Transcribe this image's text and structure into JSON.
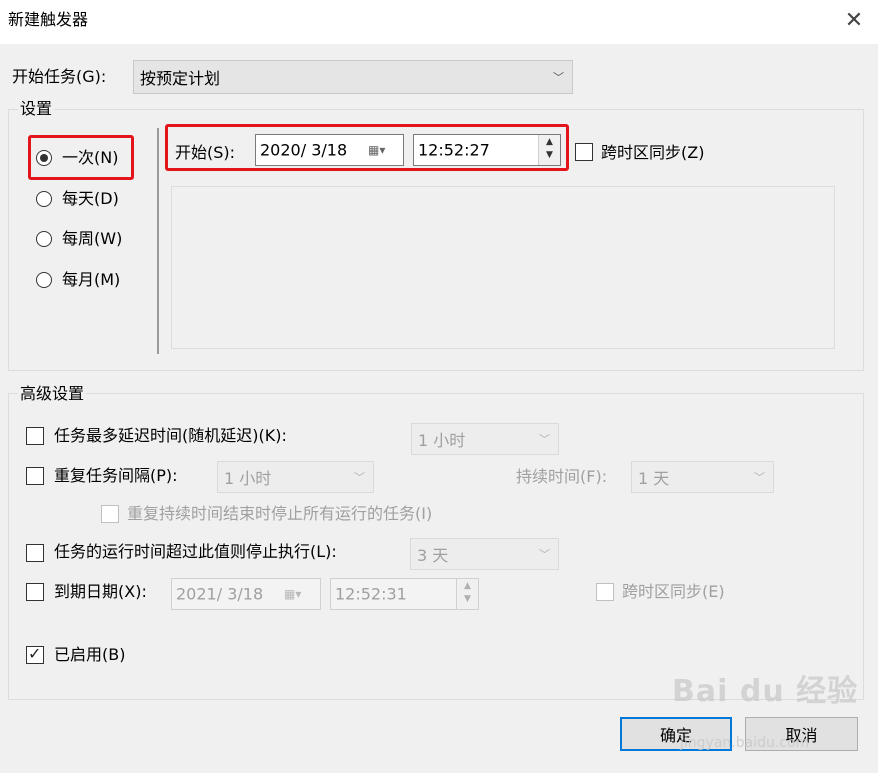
{
  "window": {
    "title": "新建触发器",
    "close_glyph": "✕"
  },
  "begin_task": {
    "label": "开始任务(G):",
    "value": "按预定计划"
  },
  "settings": {
    "title": "设置",
    "radios": [
      {
        "label": "一次(N)",
        "checked": true
      },
      {
        "label": "每天(D)",
        "checked": false
      },
      {
        "label": "每周(W)",
        "checked": false
      },
      {
        "label": "每月(M)",
        "checked": false
      }
    ],
    "start_label": "开始(S):",
    "start_date": "2020/  3/18",
    "start_time": "12:52:27",
    "sync_tz_label": "跨时区同步(Z)"
  },
  "advanced": {
    "title": "高级设置",
    "delay_label": "任务最多延迟时间(随机延迟)(K):",
    "delay_value": "1 小时",
    "repeat_label": "重复任务间隔(P):",
    "repeat_value": "1 小时",
    "duration_label": "持续时间(F):",
    "duration_value": "1 天",
    "stop_all_label": "重复持续时间结束时停止所有运行的任务(I)",
    "stop_if_label": "任务的运行时间超过此值则停止执行(L):",
    "stop_if_value": "3 天",
    "expire_label": "到期日期(X):",
    "expire_date": "2021/  3/18",
    "expire_time": "12:52:31",
    "expire_sync_label": "跨时区同步(E)",
    "enabled_label": "已启用(B)",
    "enabled_checked": true
  },
  "buttons": {
    "ok": "确定",
    "cancel": "取消"
  },
  "watermark": {
    "main": "Bai du 经验",
    "sub": "jingyan.baidu.com"
  },
  "colors": {
    "highlight": "#e4141b",
    "default_button_border": "#0078d7"
  }
}
